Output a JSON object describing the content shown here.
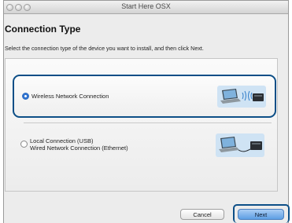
{
  "window": {
    "title": "Start Here OSX"
  },
  "page": {
    "heading": "Connection Type",
    "instruction": "Select the connection type of the device you want to install, and then click Next."
  },
  "options": [
    {
      "lines": [
        "Wireless Network Connection"
      ],
      "selected": true,
      "icon": "laptop-wifi-printer-icon"
    },
    {
      "lines": [
        "Local Connection (USB)",
        "Wired Network Connection (Ethernet)"
      ],
      "selected": false,
      "icon": "laptop-cable-printer-icon"
    }
  ],
  "buttons": {
    "cancel": "Cancel",
    "next": "Next"
  },
  "colors": {
    "highlight": "#0d4f87",
    "default_button": "#5d9fe4",
    "radio_selected": "#2f72d1"
  }
}
